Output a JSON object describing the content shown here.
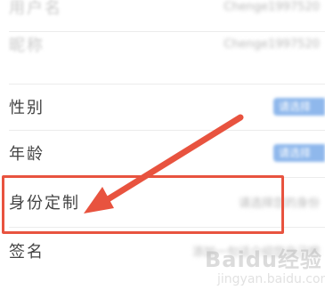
{
  "rows": [
    {
      "label": "用户名",
      "value": "Chenge1997520",
      "blurred": true
    },
    {
      "label": "昵称",
      "value": "Chenge1997520",
      "blurred": true
    },
    {
      "label": "性别",
      "value": "请选择",
      "blurred": false
    },
    {
      "label": "年龄",
      "value": "请选择",
      "blurred": false
    },
    {
      "label": "身份定制",
      "value": "请选择您的身份",
      "blurred": false
    },
    {
      "label": "签名",
      "value": "添加一句话介绍您自己吧",
      "blurred": false
    }
  ],
  "colors": {
    "annotation_red": "#e8533f",
    "pill_blue": "#8fb8ec"
  },
  "watermark": {
    "top": "Baidu经验",
    "bottom": "jingyan.baidu.com"
  }
}
